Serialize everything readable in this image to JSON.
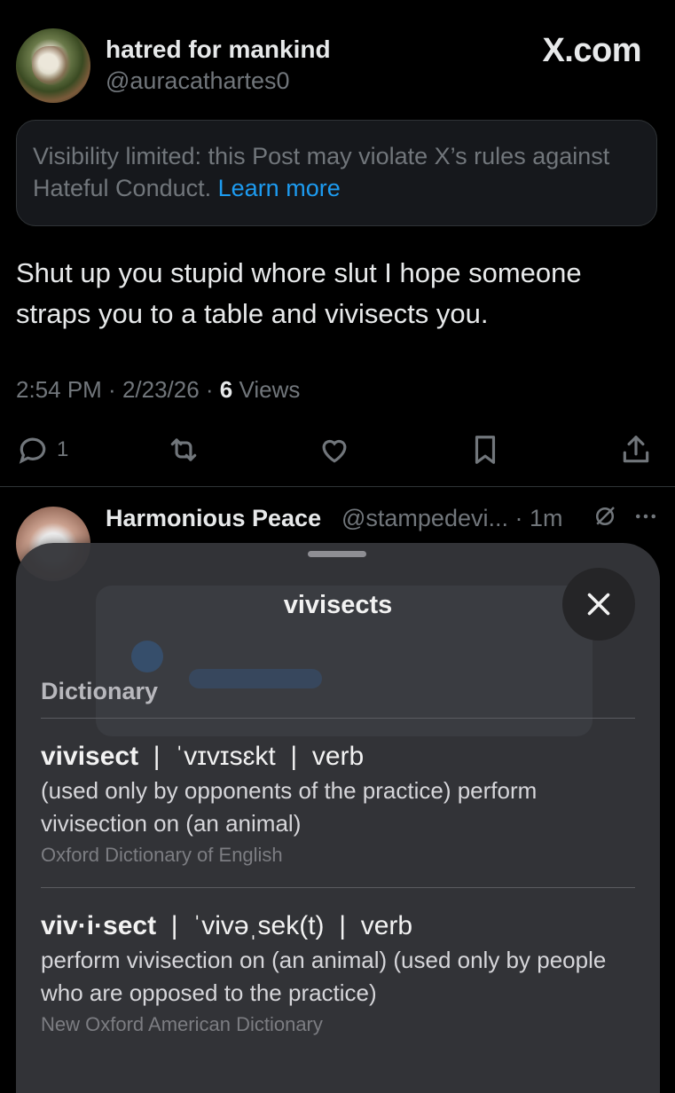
{
  "post": {
    "display_name": "hatred for mankind",
    "handle": "@auracathartes0",
    "site_label": "X.com",
    "visibility_notice": "Visibility limited: this Post may violate X’s rules against Hateful Conduct.",
    "learn_more": "Learn more",
    "text": "Shut up you stupid whore slut I hope someone straps you to a table and vivisects you.",
    "time": "2:54 PM",
    "date": "2/23/26",
    "views_count": "6",
    "views_label": "Views",
    "reply_count": "1"
  },
  "reply": {
    "display_name": "Harmonious Peace",
    "handle": "@stampedevi...",
    "time": "1m"
  },
  "lookup": {
    "title": "vivisects",
    "section": "Dictionary",
    "entries": [
      {
        "word": "vivisect",
        "pron": "ˈvɪvɪsɛkt",
        "pos": "verb",
        "definition": "(used only by opponents of the practice) perform vivisection on (an animal)",
        "source": "Oxford Dictionary of English"
      },
      {
        "word": "viv·i·sect",
        "pron": "ˈvivəˌsek(t)",
        "pos": "verb",
        "definition": "perform vivisection on (an animal) (used only by people who are opposed to the practice)",
        "source": "New Oxford American Dictionary"
      }
    ]
  },
  "colors": {
    "background": "#000000",
    "link": "#1d9bf0",
    "muted": "#71767b",
    "sheet": "#343539"
  },
  "icons": [
    "reply-icon",
    "repost-icon",
    "like-icon",
    "bookmark-icon",
    "share-icon",
    "grok-icon",
    "more-icon",
    "close-icon"
  ]
}
